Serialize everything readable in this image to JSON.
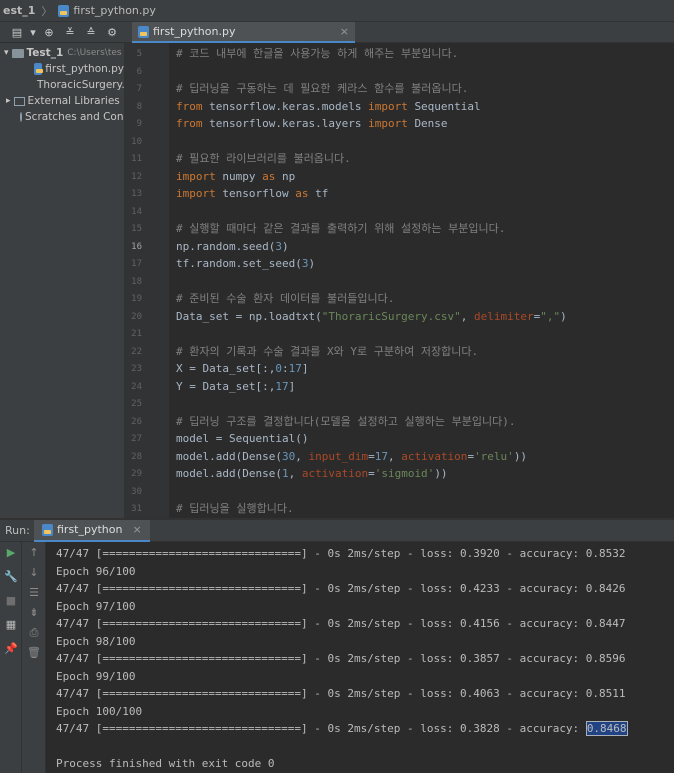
{
  "breadcrumb": {
    "project": "est_1",
    "file": "first_python.py"
  },
  "toolbar": {
    "icons": [
      "layout-icon",
      "chevron-down-icon",
      "target-icon",
      "expand-icon",
      "collapse-icon",
      "gear-icon"
    ],
    "glyphs": [
      "▤",
      "▾",
      "⊕",
      "≚",
      "≙",
      "⚙"
    ]
  },
  "editor_tab": {
    "label": "first_python.py",
    "close": "×"
  },
  "project_tree": {
    "root_label": "Test_1",
    "root_path": "C:\\Users\\tes",
    "files": [
      "first_python.py",
      "ThoracicSurgery.csv"
    ],
    "external_libraries": "External Libraries",
    "scratches": "Scratches and Conso"
  },
  "code": {
    "first_line_number": 5,
    "active_line_number": 16,
    "lines": [
      [
        {
          "t": "# 코드 내부에 한글을 사용가능 하게 해주는 부분입니다.",
          "c": "cm"
        }
      ],
      [],
      [
        {
          "t": "# 딥러닝을 구동하는 데 필요한 케라스 함수를 불러옵니다.",
          "c": "cm"
        }
      ],
      [
        {
          "t": "from ",
          "c": "kw"
        },
        {
          "t": "tensorflow.keras.models "
        },
        {
          "t": "import ",
          "c": "kw"
        },
        {
          "t": "Sequential"
        }
      ],
      [
        {
          "t": "from ",
          "c": "kw"
        },
        {
          "t": "tensorflow.keras.layers "
        },
        {
          "t": "import ",
          "c": "kw"
        },
        {
          "t": "Dense"
        }
      ],
      [],
      [
        {
          "t": "# 필요한 라이브러리를 불러옵니다.",
          "c": "cm"
        }
      ],
      [
        {
          "t": "import ",
          "c": "kw"
        },
        {
          "t": "numpy "
        },
        {
          "t": "as ",
          "c": "kw"
        },
        {
          "t": "np"
        }
      ],
      [
        {
          "t": "import ",
          "c": "kw"
        },
        {
          "t": "tensorflow "
        },
        {
          "t": "as ",
          "c": "kw"
        },
        {
          "t": "tf"
        }
      ],
      [],
      [
        {
          "t": "# 실행할 때마다 같은 결과를 출력하기 위해 설정하는 부분입니다.",
          "c": "cm"
        }
      ],
      [
        {
          "t": "np.random.seed("
        },
        {
          "t": "3",
          "c": "num"
        },
        {
          "t": ")"
        }
      ],
      [
        {
          "t": "tf.random.set_seed("
        },
        {
          "t": "3",
          "c": "num"
        },
        {
          "t": ")"
        }
      ],
      [],
      [
        {
          "t": "# 준비된 수술 환자 데이터를 불러들입니다.",
          "c": "cm"
        }
      ],
      [
        {
          "t": "Data_set = np.loadtxt("
        },
        {
          "t": "\"ThoraricSurgery.csv\"",
          "c": "str"
        },
        {
          "t": ", "
        },
        {
          "t": "delimiter",
          "c": "kwa"
        },
        {
          "t": "="
        },
        {
          "t": "\",\"",
          "c": "str"
        },
        {
          "t": ")"
        }
      ],
      [],
      [
        {
          "t": "# 환자의 기록과 수술 결과를 X와 Y로 구분하여 저장합니다.",
          "c": "cm"
        }
      ],
      [
        {
          "t": "X = Data_set[:,"
        },
        {
          "t": "0",
          "c": "num"
        },
        {
          "t": ":"
        },
        {
          "t": "17",
          "c": "num"
        },
        {
          "t": "]"
        }
      ],
      [
        {
          "t": "Y = Data_set[:,"
        },
        {
          "t": "17",
          "c": "num"
        },
        {
          "t": "]"
        }
      ],
      [],
      [
        {
          "t": "# 딥러닝 구조를 결정합니다(모델을 설정하고 실행하는 부분입니다).",
          "c": "cm"
        }
      ],
      [
        {
          "t": "model = Sequential()"
        }
      ],
      [
        {
          "t": "model.add(Dense("
        },
        {
          "t": "30",
          "c": "num"
        },
        {
          "t": ", "
        },
        {
          "t": "input_dim",
          "c": "kwa"
        },
        {
          "t": "="
        },
        {
          "t": "17",
          "c": "num"
        },
        {
          "t": ", "
        },
        {
          "t": "activation",
          "c": "kwa"
        },
        {
          "t": "="
        },
        {
          "t": "'relu'",
          "c": "str"
        },
        {
          "t": "))"
        }
      ],
      [
        {
          "t": "model.add(Dense("
        },
        {
          "t": "1",
          "c": "num"
        },
        {
          "t": ", "
        },
        {
          "t": "activation",
          "c": "kwa"
        },
        {
          "t": "="
        },
        {
          "t": "'sigmoid'",
          "c": "str"
        },
        {
          "t": "))"
        }
      ],
      [],
      [
        {
          "t": "# 딥러닝을 실행합니다.",
          "c": "cm"
        }
      ]
    ]
  },
  "run_panel": {
    "label": "Run:",
    "tab_label": "first_python",
    "close": "×",
    "left_icons": [
      "▶",
      "🔧",
      "■",
      "▦",
      "📌"
    ],
    "left_icon_names": [
      "run-icon",
      "wrench-icon",
      "stop-icon",
      "layout-icon",
      "pin-icon"
    ],
    "right_icons": [
      "↑",
      "↓",
      "☰",
      "⇟",
      "⎙",
      "🗑"
    ],
    "right_icon_names": [
      "arrow-up-icon",
      "arrow-down-icon",
      "soft-wrap-icon",
      "scroll-to-end-icon",
      "print-icon",
      "trash-icon"
    ],
    "output": [
      "47/47 [==============================] - 0s 2ms/step - loss: 0.3920 - accuracy: 0.8532",
      "Epoch 96/100",
      "47/47 [==============================] - 0s 2ms/step - loss: 0.4233 - accuracy: 0.8426",
      "Epoch 97/100",
      "47/47 [==============================] - 0s 2ms/step - loss: 0.4156 - accuracy: 0.8447",
      "Epoch 98/100",
      "47/47 [==============================] - 0s 2ms/step - loss: 0.3857 - accuracy: 0.8596",
      "Epoch 99/100",
      "47/47 [==============================] - 0s 2ms/step - loss: 0.4063 - accuracy: 0.8511",
      "Epoch 100/100",
      "47/47 [==============================] - 0s 2ms/step - loss: 0.3828 - accuracy: ",
      "",
      "Process finished with exit code 0"
    ],
    "selected_value": "0.8468"
  }
}
